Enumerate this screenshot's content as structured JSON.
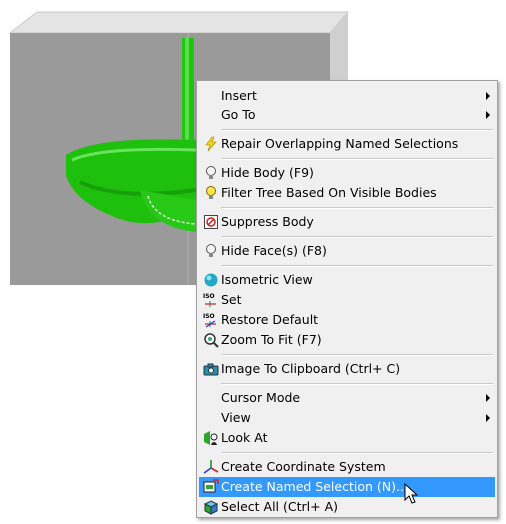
{
  "menu": {
    "items": [
      {
        "label": "Insert",
        "submenu": true
      },
      {
        "label": "Go To",
        "submenu": true
      },
      {
        "label": "Repair Overlapping Named Selections",
        "icon": "lightning-icon"
      },
      {
        "label": "Hide Body (F9)",
        "icon": "bulb-icon"
      },
      {
        "label": "Filter Tree Based On Visible Bodies",
        "icon": "bulb-on-icon"
      },
      {
        "label": "Suppress Body",
        "icon": "suppress-icon"
      },
      {
        "label": "Hide Face(s) (F8)",
        "icon": "bulb-icon"
      },
      {
        "label": "Isometric View",
        "icon": "sphere-icon"
      },
      {
        "label": "Set",
        "icon": "iso-set-icon"
      },
      {
        "label": "Restore Default",
        "icon": "iso-restore-icon"
      },
      {
        "label": "Zoom To Fit (F7)",
        "icon": "zoom-fit-icon"
      },
      {
        "label": "Image To Clipboard (Ctrl+ C)",
        "icon": "camera-icon"
      },
      {
        "label": "Cursor Mode",
        "submenu": true
      },
      {
        "label": "View",
        "submenu": true
      },
      {
        "label": "Look At",
        "icon": "look-at-icon"
      },
      {
        "label": "Create Coordinate System",
        "icon": "coordinate-system-icon"
      },
      {
        "label": "Create Named Selection (N)...",
        "icon": "named-selection-icon",
        "highlighted": true
      },
      {
        "label": "Select All (Ctrl+ A)",
        "icon": "select-all-icon"
      }
    ]
  },
  "colors": {
    "menu_bg": "#f0f0f0",
    "highlight": "#3399ff",
    "model_green": "#22cc11",
    "box_gray": "#9a9a9a"
  }
}
